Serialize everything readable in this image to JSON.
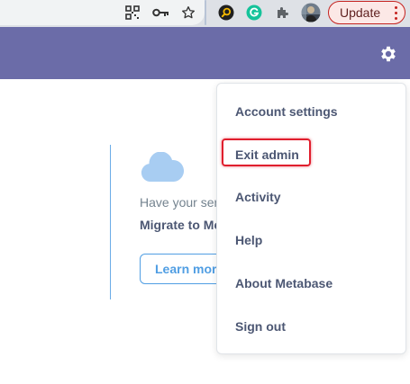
{
  "browser": {
    "update_label": "Update",
    "toolbar_icons": [
      "qr-code-icon",
      "key-icon",
      "star-icon",
      "extension-search-icon",
      "grammarly-icon",
      "puzzle-piece-icon",
      "profile-avatar"
    ]
  },
  "colors": {
    "admin_header": "#6b6ca8",
    "accent_blue": "#509ee3",
    "menu_text": "#4c5773",
    "highlight_red": "#e01e2d"
  },
  "background": {
    "partial_text": "Have your ser",
    "bold_text": "Migrate to Me",
    "button_label": "Learn more"
  },
  "menu": {
    "items": [
      {
        "label": "Account settings"
      },
      {
        "label": "Exit admin"
      },
      {
        "label": "Activity"
      },
      {
        "label": "Help"
      },
      {
        "label": "About Metabase"
      },
      {
        "label": "Sign out"
      }
    ]
  }
}
